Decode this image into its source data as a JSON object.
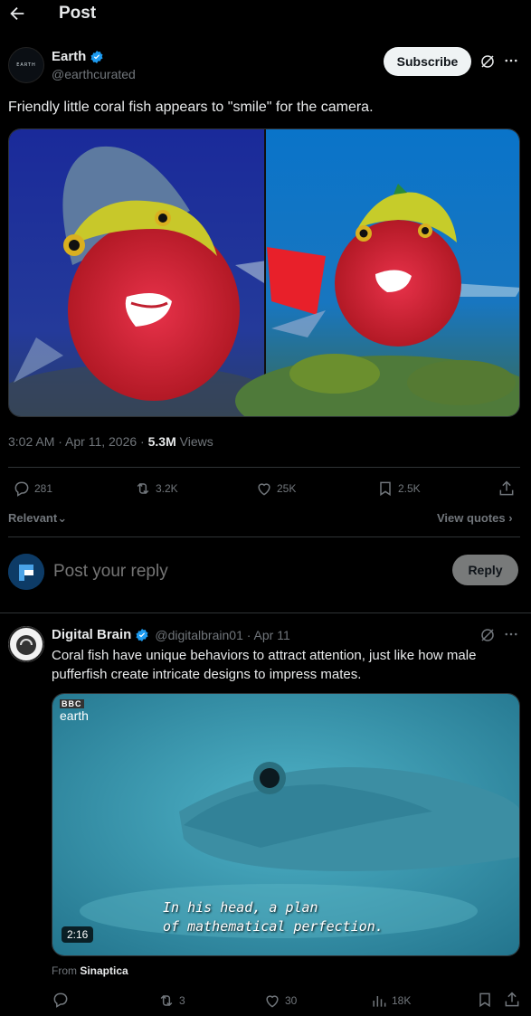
{
  "header": {
    "title": "Post"
  },
  "post": {
    "author_name": "Earth",
    "handle": "@earthcurated",
    "avatar_text": "EARTH",
    "subscribe_label": "Subscribe",
    "text": "Friendly little coral fish appears to \"smile\" for the camera.",
    "time": "3:02 AM · Apr 11, 2026 · ",
    "views_count": "5.3M",
    "views_label": " Views",
    "replies": "281",
    "reposts": "3.2K",
    "likes": "25K",
    "bookmarks": "2.5K"
  },
  "sort": {
    "relevant_label": "Relevant",
    "view_quotes_label": "View quotes"
  },
  "composer": {
    "placeholder": "Post your reply",
    "reply_label": "Reply"
  },
  "reply": {
    "author_name": "Digital Brain",
    "handle_time": "@digitalbrain01 · Apr 11",
    "text": "Coral fish have unique behaviors to attract attention, just like how male pufferfish create intricate designs to impress mates.",
    "video_logo_top": "BBC",
    "video_logo_bottom": "earth",
    "subtitle_line1": "In his head, a plan",
    "subtitle_line2": "of mathematical perfection.",
    "duration": "2:16",
    "from_label": "From ",
    "from_source": "Sinaptica",
    "replies": "",
    "reposts": "3",
    "likes": "30",
    "views": "18K"
  },
  "colors": {
    "verified": "#1d9bf0",
    "background": "#000000",
    "muted": "#71767b"
  }
}
